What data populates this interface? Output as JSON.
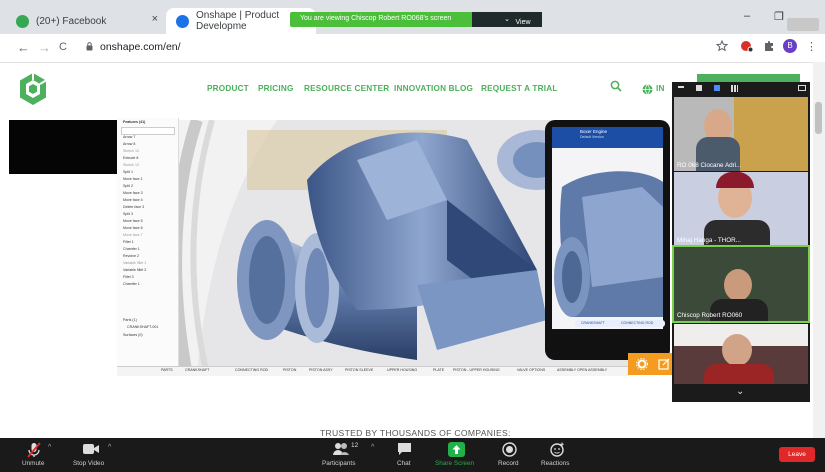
{
  "browser": {
    "tabs": [
      {
        "label": "(20+) Facebook",
        "close": "×"
      },
      {
        "label": "Onshape | Product Developme",
        "close": "×"
      }
    ],
    "new_tab": "+",
    "window_controls": {
      "minimize": "–",
      "restore": "❐",
      "close": "✕"
    },
    "nav": {
      "back": "←",
      "forward": "→",
      "reload": "C"
    },
    "url": "onshape.com/en/",
    "toolbar_icons": [
      "star-icon",
      "extension-icon",
      "puzzle-icon",
      "profile-avatar",
      "menu-icon"
    ],
    "profile_initial": "B",
    "menu_glyph": "⋮"
  },
  "screen_share": {
    "banner": "You are viewing Chiscop Robert  RO068's screen",
    "view_options": "View Options"
  },
  "site": {
    "nav": [
      "PRODUCT",
      "PRICING",
      "RESOURCE CENTER",
      "INNOVATION BLOG",
      "REQUEST A TRIAL"
    ],
    "lang": "IN",
    "trusted": "TRUSTED BY THOUSANDS OF COMPANIES:"
  },
  "cad": {
    "tree_title": "Features (41)",
    "tree_items": [
      "Arrow 7",
      "Arrow 8",
      "Sketch 10",
      "Extrude 8",
      "Sketch 13",
      "Split 1",
      "Move face 1",
      "Split 2",
      "Move face 3",
      "Move face 4",
      "Delete face 3",
      "Split 3",
      "Move face 5",
      "Move face 6",
      "Move face 7",
      "Fillet 1",
      "Chamfer 1",
      "Revolve 2",
      "Variable fillet 1",
      "Variable fillet 2",
      "Fillet 3",
      "Chamfer 1"
    ],
    "parts": "Parts (1)",
    "part_name": "CRANKSHAFT-001",
    "surfaces": "Surfaces (0)",
    "bottom_tabs": [
      "PARTS",
      "CRANKSHAFT",
      "CONNECTING ROD",
      "PISTON",
      "PISTON ASSY",
      "PISTON SLEEVE",
      "UPPER HOUSING",
      "PLATE",
      "PISTON - UPPER HOUSING",
      "VALVE OPTIONS",
      "ASSEMBLY OPEN ASSEMBLY"
    ],
    "phone_title": "Boxer Engine",
    "phone_subtitle": "Default Version",
    "phone_tab1": "CRANKSHAFT",
    "phone_tab2": "CONNECTING ROD"
  },
  "video": {
    "participants": [
      {
        "name": "RO 068 Ciocane Adri..."
      },
      {
        "name": "Mihaj Hanga - THOR..."
      },
      {
        "name": "Chiscop Robert RO060"
      },
      {
        "name": ""
      }
    ],
    "more": "⌄"
  },
  "zoom": {
    "unmute": "Unmute",
    "stop_video": "Stop Video",
    "participants": "Participants",
    "participant_count": "12",
    "chat": "Chat",
    "share_screen": "Share Screen",
    "record": "Record",
    "reactions": "Reactions",
    "leave": "Leave"
  },
  "colors": {
    "onshape_green": "#4cb05c",
    "share_green": "#4bbf3a",
    "leave_red": "#e02828",
    "cad_orange": "#f39c1f",
    "phone_blue": "#1c4ea5"
  }
}
